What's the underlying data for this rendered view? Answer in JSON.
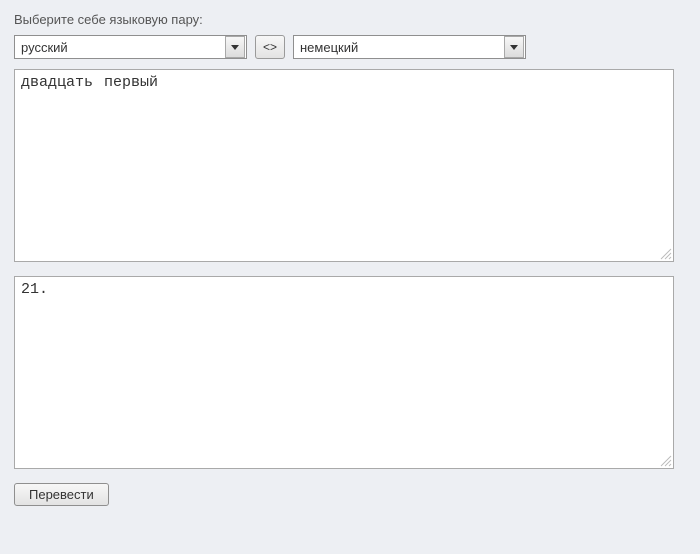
{
  "prompt": "Выберите себе языковую пару:",
  "source_lang": "русский",
  "target_lang": "немецкий",
  "swap_symbol": "<>",
  "input_text": "двадцать первый",
  "output_text": "21.",
  "translate_label": "Перевести"
}
